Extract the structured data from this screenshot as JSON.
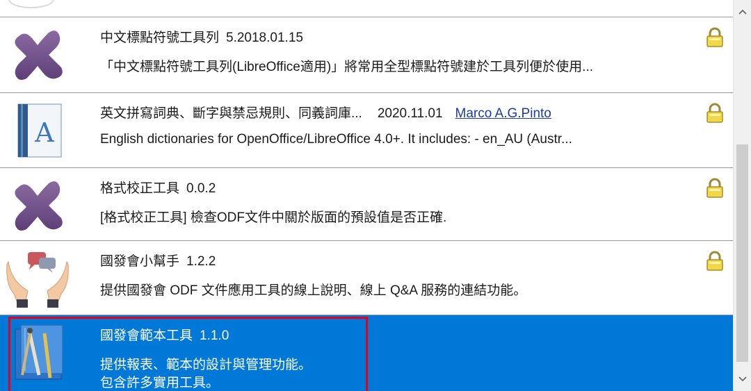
{
  "extensions": [
    {
      "title": "中文標點符號工具列",
      "version": "5.2018.01.15",
      "author": "",
      "description": "「中文標點符號工具列(LibreOffice適用)」將常用全型標點符號建於工具列便於使用...",
      "icon": "puzzle-icon",
      "locked": true
    },
    {
      "title": "英文拼寫詞典、斷字與禁忌規則、同義詞庫...",
      "version": "2020.11.01",
      "author": "Marco A.G.Pinto",
      "description": "English dictionaries for OpenOffice/LibreOffice 4.0+.  It includes: - en_AU (Austr...",
      "icon": "dictionary-book-icon",
      "locked": true
    },
    {
      "title": "格式校正工具",
      "version": "0.0.2",
      "author": "",
      "description": "[格式校正工具] 檢查ODF文件中關於版面的預設值是否正確.",
      "icon": "puzzle-icon",
      "locked": true
    },
    {
      "title": "國發會小幫手",
      "version": "1.2.2",
      "author": "",
      "description": "提供國發會 ODF 文件應用工具的線上說明、線上 Q&A 服務的連結功能。",
      "icon": "helping-hands-icon",
      "locked": true
    },
    {
      "title": "國發會範本工具",
      "version": "1.1.0",
      "author": "",
      "description": "提供報表、範本的設計與管理功能。",
      "description_line2": "包含許多實用工具。",
      "icon": "template-tools-icon",
      "locked": false,
      "selected": true
    }
  ],
  "colors": {
    "selection": "#0078d7",
    "highlight_border": "#e2001a",
    "link": "#1c3aa9"
  }
}
